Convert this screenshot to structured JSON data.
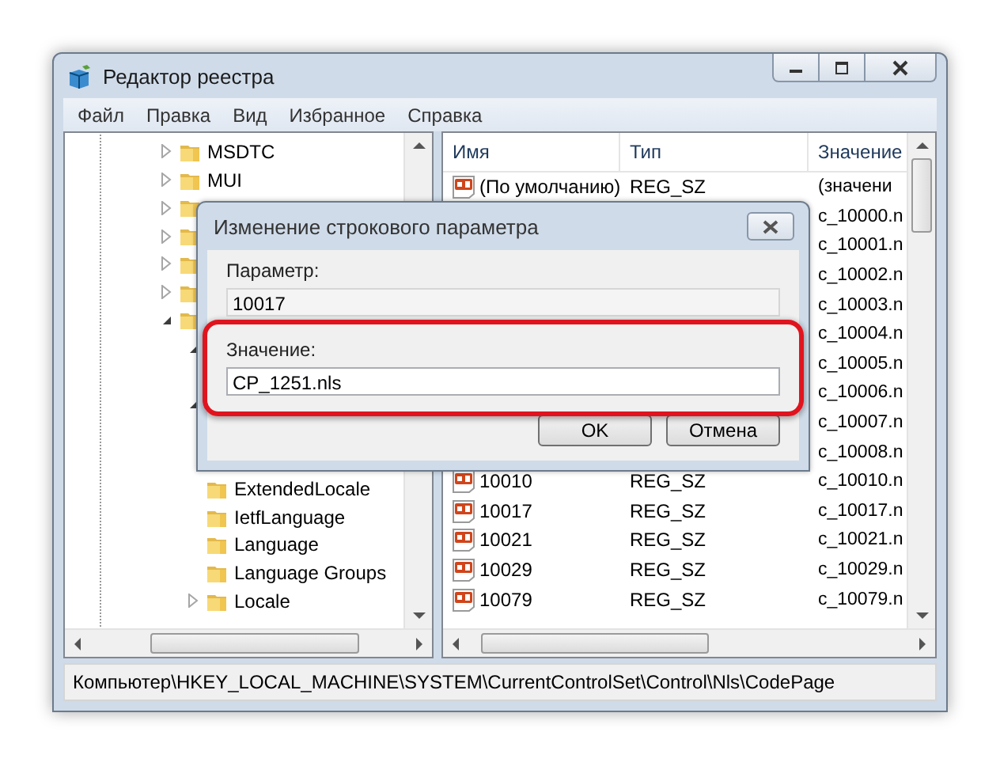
{
  "window": {
    "title": "Редактор реестра"
  },
  "menu": [
    "Файл",
    "Правка",
    "Вид",
    "Избранное",
    "Справка"
  ],
  "tree": {
    "items": [
      {
        "kind": "key",
        "label": "MSDTC",
        "expanded": false
      },
      {
        "kind": "key",
        "label": "MUI",
        "expanded": false
      },
      {
        "kind": "key",
        "expanded": false
      },
      {
        "kind": "key",
        "expanded": false
      },
      {
        "kind": "key",
        "expanded": false
      },
      {
        "kind": "key",
        "expanded": false
      },
      {
        "kind": "key",
        "expanded": true,
        "children": [
          {
            "kind": "key",
            "expanded": true
          },
          {
            "kind": "key"
          },
          {
            "kind": "key",
            "expanded": true
          },
          {
            "kind": "key"
          },
          {
            "kind": "key"
          },
          {
            "kind": "key",
            "label": "ExtendedLocale"
          },
          {
            "kind": "key",
            "label": "IetfLanguage"
          },
          {
            "kind": "key",
            "label": "Language"
          },
          {
            "kind": "key",
            "label": "Language Groups"
          },
          {
            "kind": "key",
            "label": "Locale",
            "expanded": false
          }
        ]
      }
    ]
  },
  "list": {
    "columns": [
      "Имя",
      "Тип",
      "Значение"
    ],
    "rows": [
      {
        "name": "(По умолчанию)",
        "type": "REG_SZ",
        "value": "(значени"
      },
      {
        "value": "c_10000.n"
      },
      {
        "value": "c_10001.n"
      },
      {
        "value": "c_10002.n"
      },
      {
        "value": "c_10003.n"
      },
      {
        "value": "c_10004.n"
      },
      {
        "value": "c_10005.n"
      },
      {
        "value": "c_10006.n"
      },
      {
        "value": "c_10007.n"
      },
      {
        "value": "c_10008.n"
      },
      {
        "name": "10010",
        "type": "REG_SZ",
        "value": "c_10010.n"
      },
      {
        "name": "10017",
        "type": "REG_SZ",
        "value": "c_10017.n"
      },
      {
        "name": "10021",
        "type": "REG_SZ",
        "value": "c_10021.n"
      },
      {
        "name": "10029",
        "type": "REG_SZ",
        "value": "c_10029.n"
      },
      {
        "name": "10079",
        "type": "REG_SZ",
        "value": "c_10079.n"
      }
    ]
  },
  "status_bar": "Компьютер\\HKEY_LOCAL_MACHINE\\SYSTEM\\CurrentControlSet\\Control\\Nls\\CodePage",
  "dialog": {
    "title": "Изменение строкового параметра",
    "parameter_label": "Параметр:",
    "parameter_value": "10017",
    "value_label": "Значение:",
    "value": "CP_1251.nls",
    "buttons": [
      "OK",
      "Отмена"
    ]
  }
}
